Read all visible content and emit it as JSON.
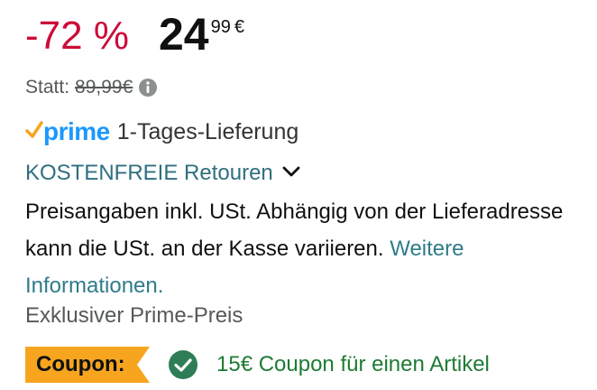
{
  "price": {
    "discount": "-72 %",
    "whole": "24",
    "fraction": "99",
    "currency": "€",
    "list_label": "Statt:",
    "list_price": "89,99€",
    "info_icon": "info-icon"
  },
  "delivery": {
    "prime_check_icon": "prime-check-icon",
    "prime_word": "prime",
    "text": "1-Tages-Lieferung"
  },
  "returns": {
    "text": "KOSTENFREIE Retouren",
    "chevron_icon": "chevron-down-icon"
  },
  "description": {
    "text": "Preisangaben inkl. USt. Abhängig von der Lieferadresse kann die USt. an der Kasse variieren.",
    "link": "Weitere Informationen."
  },
  "prime_price_text": "Exklusiver Prime-Preis",
  "coupon": {
    "badge_label": "Coupon:",
    "check_icon": "check-circle-icon",
    "text": "15€ Coupon für einen Artikel"
  },
  "colors": {
    "discount": "#cc0c39",
    "prime_blue": "#1a98ff",
    "prime_check": "#f7a51f",
    "link": "#2f7c89",
    "coupon_badge": "#f7a51f",
    "coupon_green": "#1e7b34",
    "check_circle": "#2e7d56"
  }
}
